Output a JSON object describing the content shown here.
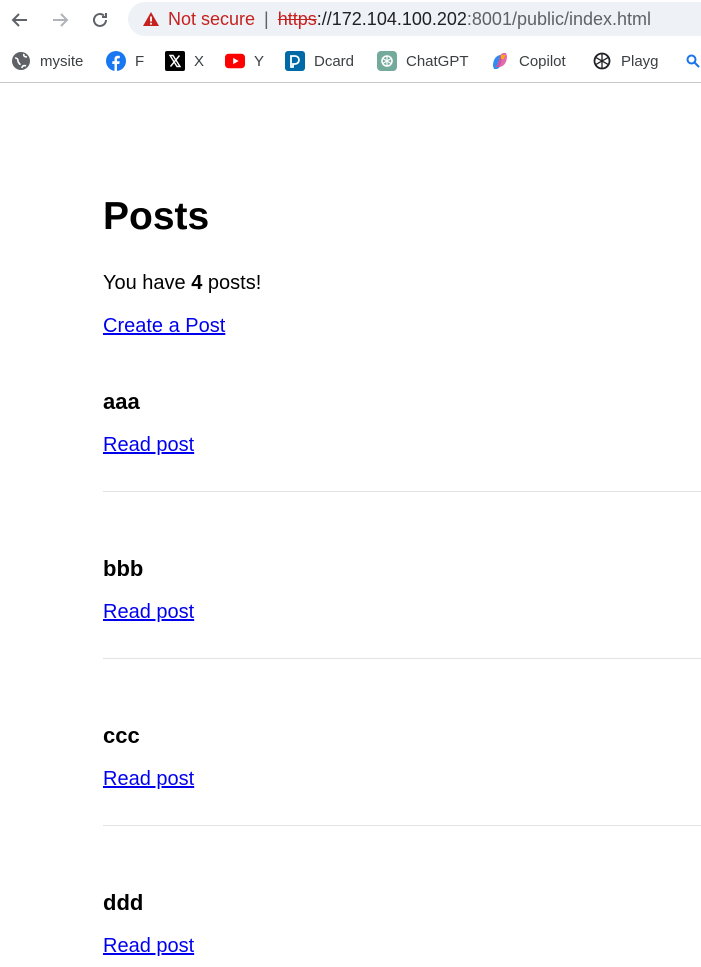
{
  "browser": {
    "security_label": "Not secure",
    "url_scheme": "https",
    "url_host": "://172.104.100.202",
    "url_path": ":8001/public/index.html",
    "bookmarks": [
      {
        "label": "mysite",
        "icon": "globe-icon"
      },
      {
        "label": "F",
        "icon": "facebook-icon",
        "color": "#1877f2"
      },
      {
        "label": "X",
        "icon": "x-icon",
        "color": "#000000"
      },
      {
        "label": "Y",
        "icon": "youtube-icon",
        "color": "#ff0000"
      },
      {
        "label": "Dcard",
        "icon": "dcard-icon",
        "color": "#006aa6"
      },
      {
        "label": "ChatGPT",
        "icon": "chatgpt-icon",
        "color": "#74aa9c"
      },
      {
        "label": "Copilot",
        "icon": "copilot-icon"
      },
      {
        "label": "Playg",
        "icon": "openai-icon"
      }
    ]
  },
  "page": {
    "title": "Posts",
    "summary_prefix": "You have ",
    "post_count": "4",
    "summary_suffix": " posts!",
    "create_link": "Create a Post",
    "posts": [
      {
        "title": "aaa",
        "link": "Read post"
      },
      {
        "title": "bbb",
        "link": "Read post"
      },
      {
        "title": "ccc",
        "link": "Read post"
      },
      {
        "title": "ddd",
        "link": "Read post"
      }
    ]
  },
  "colors": {
    "link": "#0000ee",
    "insecure": "#c5221f"
  }
}
